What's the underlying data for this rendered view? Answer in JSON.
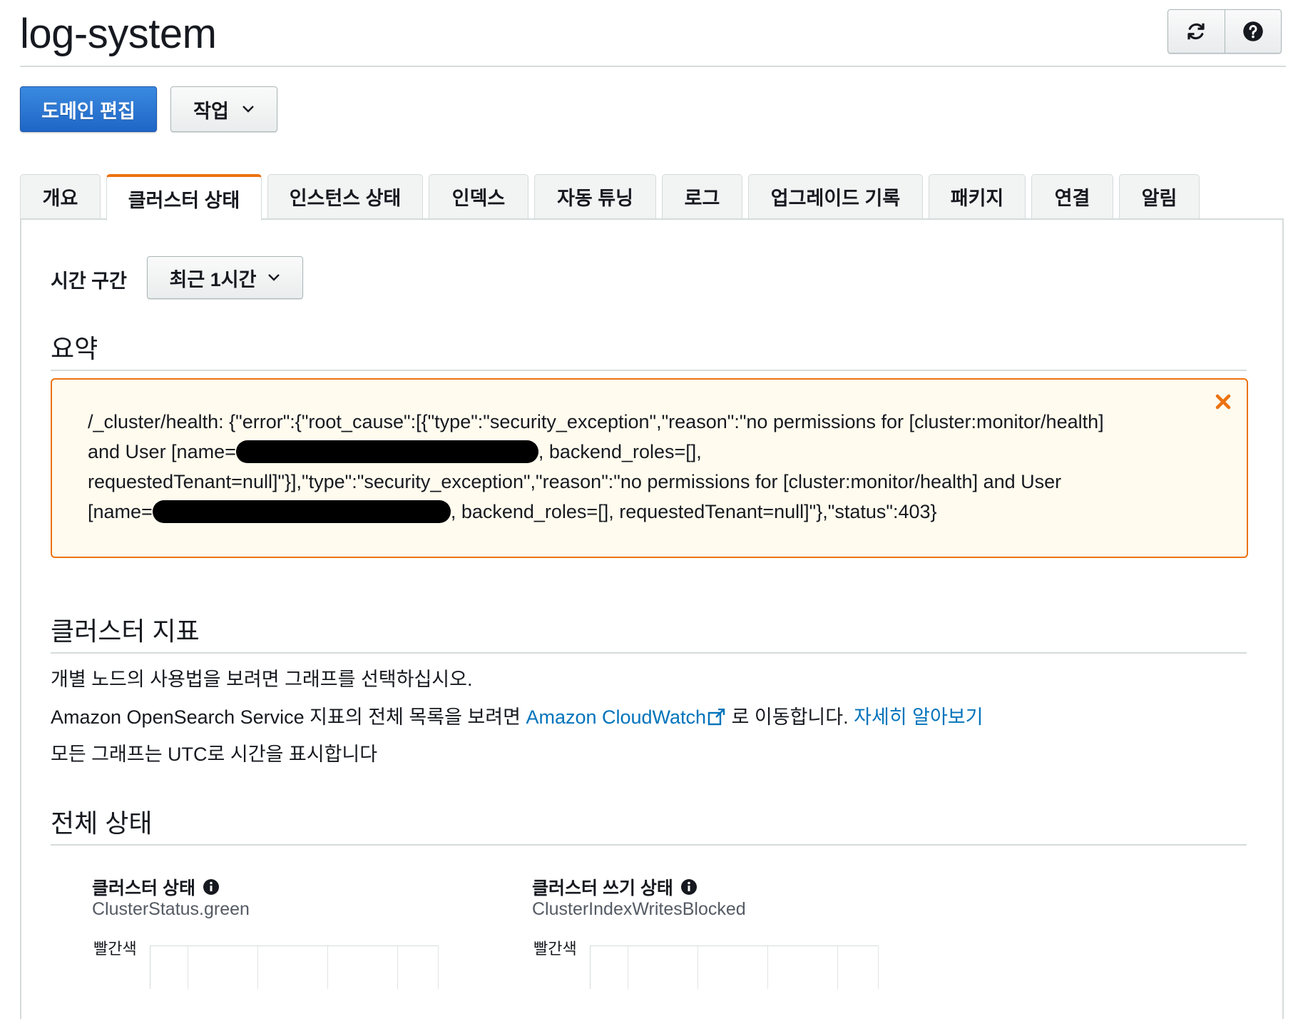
{
  "header": {
    "title": "log-system",
    "refresh_icon": "refresh-icon",
    "help_icon": "help-icon"
  },
  "actions": {
    "edit_domain": "도메인 편집",
    "actions_menu": "작업"
  },
  "tabs": [
    {
      "label": "개요"
    },
    {
      "label": "클러스터 상태",
      "active": true
    },
    {
      "label": "인스턴스 상태"
    },
    {
      "label": "인덱스"
    },
    {
      "label": "자동 튜닝"
    },
    {
      "label": "로그"
    },
    {
      "label": "업그레이드 기록"
    },
    {
      "label": "패키지"
    },
    {
      "label": "연결"
    },
    {
      "label": "알림"
    }
  ],
  "time_range": {
    "label": "시간 구간",
    "value": "최근 1시간"
  },
  "summary": {
    "heading": "요약",
    "alert": {
      "line1": "/_cluster/health: {\"error\":{\"root_cause\":[{\"type\":\"security_exception\",\"reason\":\"no permissions for [cluster:monitor/health]",
      "line2_pre": "and User [name=",
      "line2_post": ", backend_roles=[],",
      "line3": "requestedTenant=null]\"}],\"type\":\"security_exception\",\"reason\":\"no permissions for [cluster:monitor/health] and User",
      "line4_pre": "[name=",
      "line4_post": ", backend_roles=[], requestedTenant=null]\"},\"status\":403}"
    },
    "accent_color": "#ec7211"
  },
  "cluster_metrics": {
    "heading": "클러스터 지표",
    "para1": "개별 노드의 사용법을 보려면 그래프를 선택하십시오.",
    "para2_pre": "Amazon OpenSearch Service 지표의 전체 목록을 보려면 ",
    "para2_link": "Amazon CloudWatch",
    "para2_mid": " 로 이동합니다. ",
    "para2_learn_more": "자세히 알아보기",
    "para3": "모든 그래프는 UTC로 시간을 표시합니다"
  },
  "overall_status": {
    "heading": "전체 상태",
    "metrics": [
      {
        "title": "클러스터 상태",
        "subtitle": "ClusterStatus.green",
        "y_label": "빨간색"
      },
      {
        "title": "클러스터 쓰기 상태",
        "subtitle": "ClusterIndexWritesBlocked",
        "y_label": "빨간색"
      }
    ]
  },
  "colors": {
    "primary_button": "#1f66c6",
    "link": "#0073bb",
    "alert_bg": "#fffbee"
  }
}
